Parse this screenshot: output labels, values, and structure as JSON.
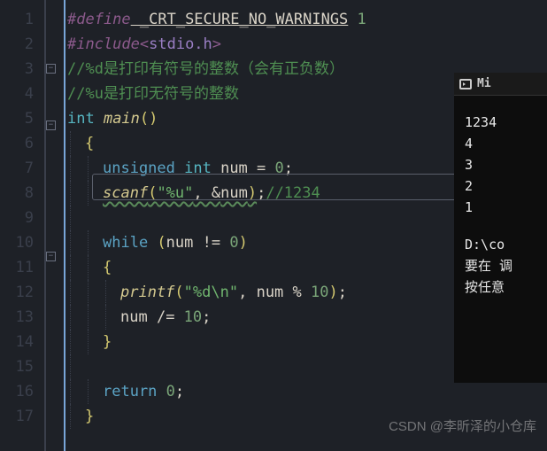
{
  "gutter": {
    "lines": [
      "1",
      "2",
      "3",
      "4",
      "5",
      "6",
      "7",
      "8",
      "9",
      "10",
      "11",
      "12",
      "13",
      "14",
      "15",
      "16",
      "17"
    ]
  },
  "code": {
    "line1": {
      "define": "#define",
      "name": " _CRT_SECURE_NO_WARNINGS",
      "val": " 1"
    },
    "line2": {
      "include": "#include<",
      "header": "stdio.h",
      "end": ">"
    },
    "line3": {
      "comment": "//%d是打印有符号的整数（会有正负数）"
    },
    "line4": {
      "comment": "//%u是打印无符号的整数"
    },
    "line5": {
      "type": "int ",
      "func": "main",
      "paren": "()"
    },
    "line6": {
      "brace": "{"
    },
    "line7": {
      "kw": "unsigned ",
      "type": "int ",
      "ident": "num",
      "op": " = ",
      "num": "0",
      "semi": ";"
    },
    "line8": {
      "func": "scanf",
      "open": "(",
      "str": "\"%u\"",
      "comma": ", &",
      "ident": "num",
      "close": ")",
      "semi": ";",
      "comment": "//1234"
    },
    "line9": {
      "blank": ""
    },
    "line10": {
      "kw": "while ",
      "open": "(",
      "ident": "num",
      "op": " != ",
      "num": "0",
      "close": ")"
    },
    "line11": {
      "brace": "{"
    },
    "line12": {
      "func": "printf",
      "open": "(",
      "str": "\"%d\\n\"",
      "comma": ", ",
      "ident": "num",
      "op2": " % ",
      "num": "10",
      "close": ")",
      "semi": ";"
    },
    "line13": {
      "ident": "num",
      "op": " /= ",
      "num": "10",
      "semi": ";"
    },
    "line14": {
      "brace": "}"
    },
    "line15": {
      "blank": ""
    },
    "line16": {
      "kw": "return ",
      "num": "0",
      "semi": ";"
    },
    "line17": {
      "brace": "}"
    }
  },
  "console": {
    "title": "Mi",
    "input": "1234",
    "out1": "4",
    "out2": "3",
    "out3": "2",
    "out4": "1",
    "path": "D:\\co",
    "msg1": "要在 调",
    "msg2": "按任意"
  },
  "watermark": "CSDN @李昕泽的小仓库"
}
